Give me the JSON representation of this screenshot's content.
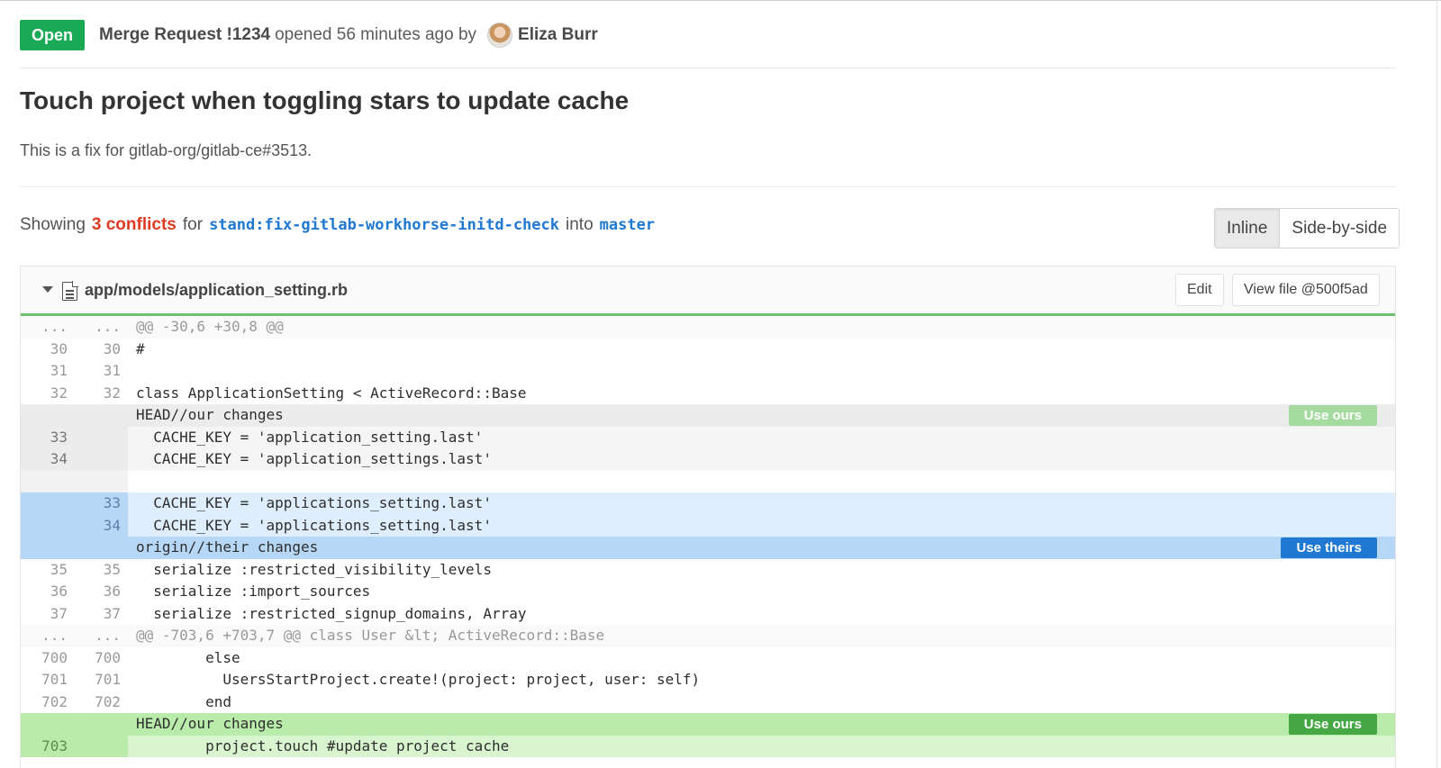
{
  "mr": {
    "status": "Open",
    "ref": "Merge Request !1234",
    "opened_text": "opened 56 minutes ago by",
    "author": "Eliza Burr",
    "title": "Touch project when toggling stars to update cache",
    "description": "This is a fix for gitlab-org/gitlab-ce#3513."
  },
  "conflicts": {
    "showing": "Showing",
    "count": "3 conflicts",
    "for": "for",
    "source_branch": "stand:fix-gitlab-workhorse-initd-check",
    "into": "into",
    "target_branch": "master"
  },
  "view_toggle": {
    "inline": "Inline",
    "side_by_side": "Side-by-side",
    "active": "inline"
  },
  "file": {
    "path": "app/models/application_setting.rb",
    "edit_label": "Edit",
    "view_label": "View file @500f5ad",
    "lines": [
      {
        "type": "match",
        "old": "...",
        "new": "...",
        "text": "@@ -30,6 +30,8 @@"
      },
      {
        "type": "normal",
        "old": "30",
        "new": "30",
        "text": "#"
      },
      {
        "type": "normal",
        "old": "31",
        "new": "31",
        "text": ""
      },
      {
        "type": "normal",
        "old": "32",
        "new": "32",
        "text": "class ApplicationSetting < ActiveRecord::Base"
      },
      {
        "type": "head-ours",
        "old": "",
        "new": "",
        "text": "HEAD//our changes",
        "button": "Use ours"
      },
      {
        "type": "ours",
        "old": "33",
        "new": "",
        "text": "  CACHE_KEY = 'application_setting.last'"
      },
      {
        "type": "ours",
        "old": "34",
        "new": "",
        "text": "  CACHE_KEY = 'application_settings.last'"
      },
      {
        "type": "sep",
        "old": "",
        "new": "",
        "text": ""
      },
      {
        "type": "theirs",
        "old": "",
        "new": "33",
        "text": "  CACHE_KEY = 'applications_setting.last'"
      },
      {
        "type": "theirs",
        "old": "",
        "new": "34",
        "text": "  CACHE_KEY = 'applications_setting.last'"
      },
      {
        "type": "head-theirs",
        "old": "",
        "new": "",
        "text": "origin//their changes",
        "button": "Use theirs"
      },
      {
        "type": "normal",
        "old": "35",
        "new": "35",
        "text": "  serialize :restricted_visibility_levels"
      },
      {
        "type": "normal",
        "old": "36",
        "new": "36",
        "text": "  serialize :import_sources"
      },
      {
        "type": "normal",
        "old": "37",
        "new": "37",
        "text": "  serialize :restricted_signup_domains, Array"
      },
      {
        "type": "match",
        "old": "...",
        "new": "...",
        "text": "@@ -703,6 +703,7 @@ class User &lt; ActiveRecord::Base"
      },
      {
        "type": "normal",
        "old": "700",
        "new": "700",
        "text": "        else"
      },
      {
        "type": "normal",
        "old": "701",
        "new": "701",
        "text": "          UsersStartProject.create!(project: project, user: self)"
      },
      {
        "type": "normal",
        "old": "702",
        "new": "702",
        "text": "        end"
      },
      {
        "type": "head-ours-g",
        "old": "",
        "new": "",
        "text": "HEAD//our changes",
        "button": "Use ours"
      },
      {
        "type": "ours-g",
        "old": "703",
        "new": "",
        "text": "        project.touch #update project cache"
      }
    ]
  }
}
